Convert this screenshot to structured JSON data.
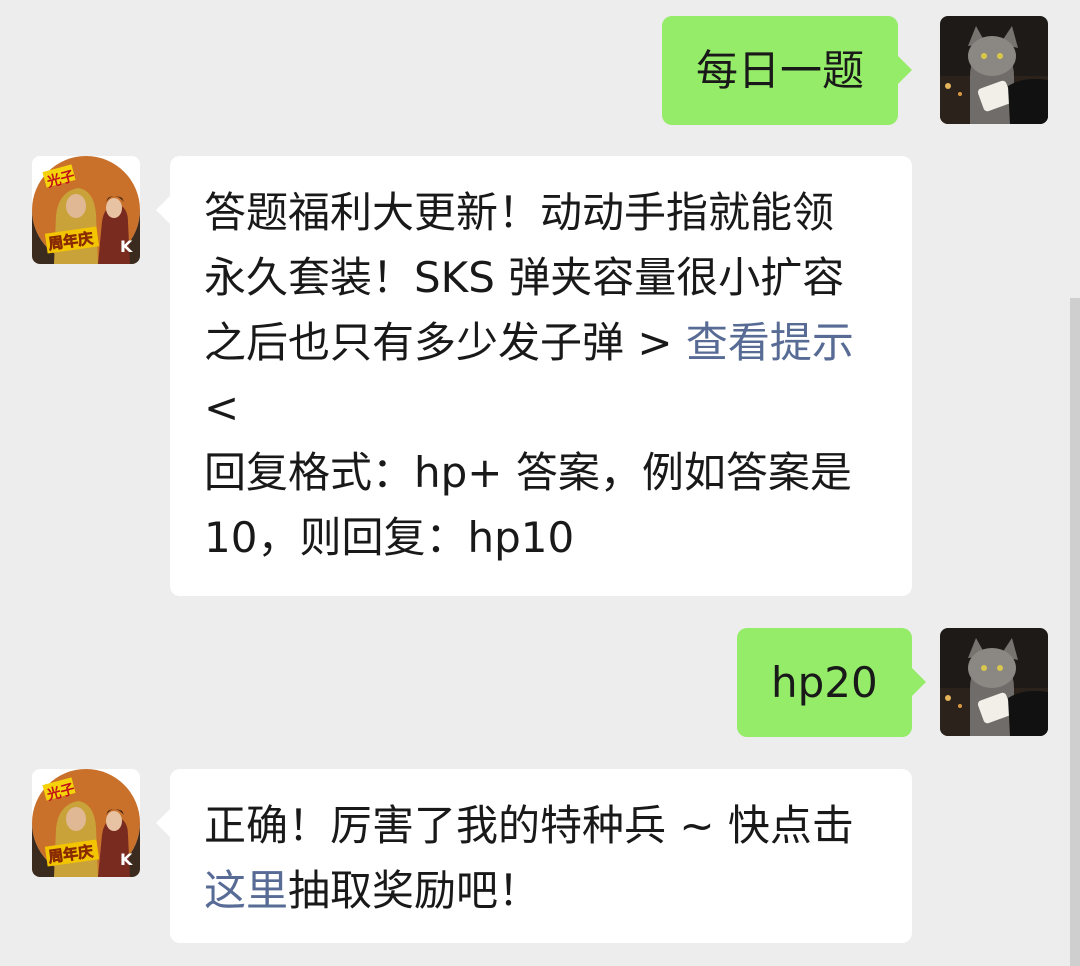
{
  "messages": {
    "m1": {
      "text": "每日一题"
    },
    "m2": {
      "lines": [
        "答题福利大更新！动动手指就能领",
        "永久套装！SKS 弹夹容量很小扩容",
        "之后也只有多少发子弹 >",
        "<",
        "回复格式：hp+ 答案，例如答案是",
        "10，则回复：hp10"
      ],
      "link": "查看提示"
    },
    "m3": {
      "text": "hp20"
    },
    "m4": {
      "line1": "正确！厉害了我的特种兵 ~ 快点击",
      "link": "这里",
      "tail": "抽取奖励吧！"
    }
  },
  "avatars": {
    "self": {
      "icon": "cat-photo-avatar"
    },
    "bot": {
      "icon": "game-anniversary-avatar",
      "badge_top": "光子",
      "badge_bottom": "周年庆"
    }
  },
  "colors": {
    "background": "#ededed",
    "self_bubble": "#95ec69",
    "bot_bubble": "#ffffff",
    "link": "#576b95"
  }
}
